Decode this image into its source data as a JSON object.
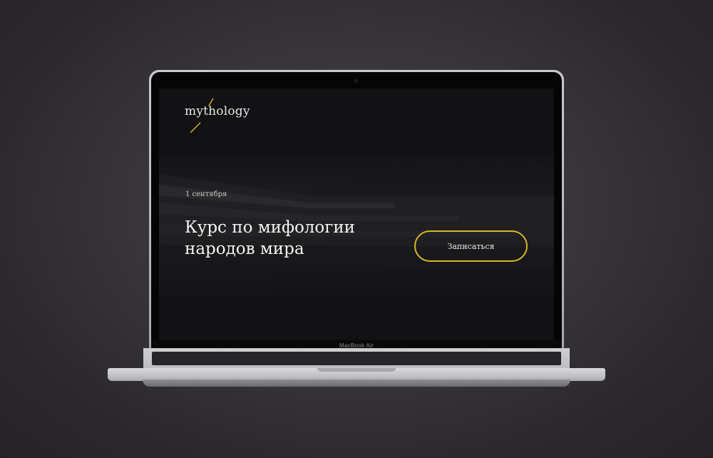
{
  "device": {
    "model_label": "MacBook Air"
  },
  "site": {
    "logo_text": "mythology",
    "date": "1 сентября",
    "title_line1": "Курс по мифологии",
    "title_line2": "народов мира",
    "cta_label": "Записаться",
    "colors": {
      "accent": "#d8b62a",
      "background": "#141416",
      "text": "#f2f2f2"
    }
  }
}
